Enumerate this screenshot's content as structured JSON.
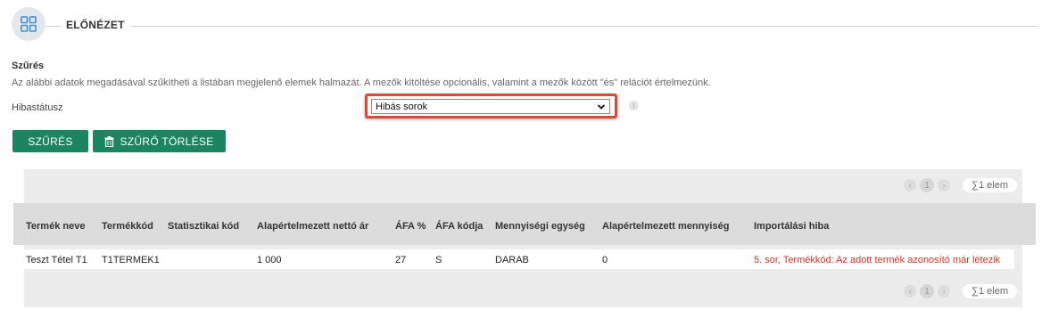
{
  "header": {
    "title": "ELŐNÉZET",
    "icon": "grid-icon",
    "accent": "#3d8fd8"
  },
  "filter": {
    "title": "Szűrés",
    "description": "Az alábbi adatok megadásával szűkítheti a listában megjelenő elemek halmazát. A mezők kitöltése opcionális, valamint a mezők között \"és\" relációt értelmezünk.",
    "status_label": "Hibastátusz",
    "status_value": "Hibás sorok",
    "filter_button": "SZŰRÉS",
    "clear_button": "SZŰRŐ TÖRLÉSE"
  },
  "pager": {
    "page": "1",
    "count": "∑1 elem"
  },
  "table": {
    "columns": [
      "Termék neve",
      "Termékkód",
      "Statisztikai kód",
      "Alapértelmezett nettó ár",
      "ÁFA %",
      "ÁFA kódja",
      "Mennyiségi egység",
      "Alapértelmezett mennyiség",
      "Importálási hiba"
    ],
    "rows": [
      [
        "Teszt Tétel T1",
        "T1TERMEK1",
        "",
        "1 000",
        "27",
        "S",
        "DARAB",
        "0",
        "5. sor, Termékkód: Az adott termék azonosító már létezik"
      ]
    ]
  },
  "colors": {
    "primary_button": "#1a8561",
    "error_text": "#e0301e",
    "highlight": "#e0492f"
  }
}
